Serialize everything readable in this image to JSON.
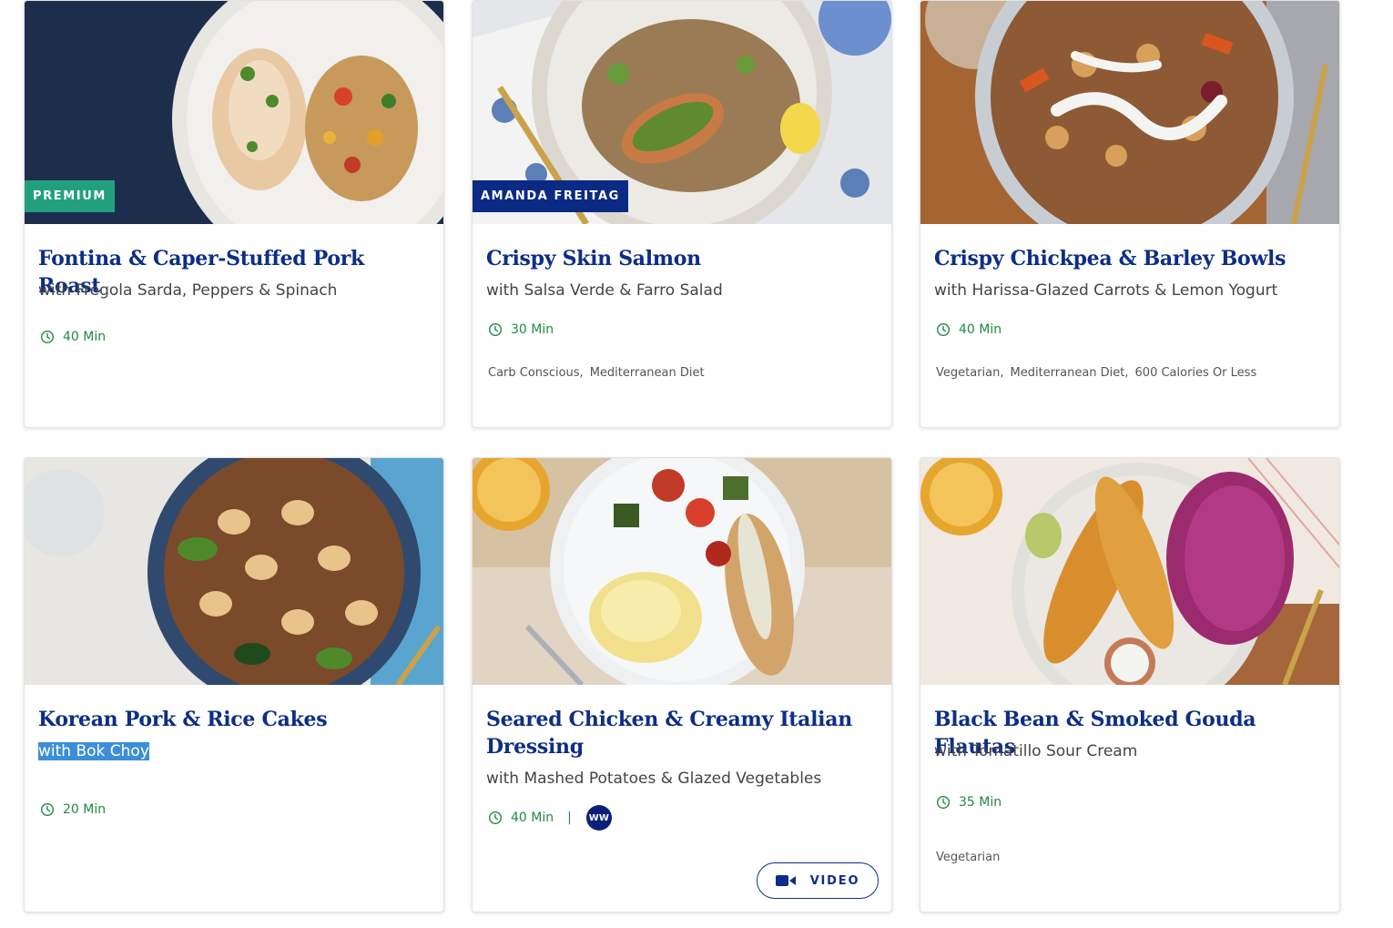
{
  "recipes": [
    {
      "badge": "PREMIUM",
      "title": "Fontina & Caper-Stuffed Pork Roast",
      "subtitle": "with Fregola Sarda, Peppers & Spinach",
      "time": "40 Min",
      "tags": []
    },
    {
      "badge": "AMANDA FREITAG",
      "title": "Crispy Skin Salmon",
      "subtitle": "with Salsa Verde & Farro Salad",
      "time": "30 Min",
      "tags": [
        "Carb Conscious,",
        "Mediterranean Diet"
      ]
    },
    {
      "badge": "",
      "title": "Crispy Chickpea & Barley Bowls",
      "subtitle": "with Harissa-Glazed Carrots & Lemon Yogurt",
      "time": "40 Min",
      "tags": [
        "Vegetarian,",
        "Mediterranean Diet,",
        "600 Calories Or Less"
      ]
    },
    {
      "badge": "",
      "title": "Korean Pork & Rice Cakes",
      "subtitle": "with Bok Choy",
      "time": "20 Min",
      "tags": []
    },
    {
      "badge": "",
      "title": "Seared Chicken & Creamy Italian Dressing",
      "subtitle": "with Mashed Potatoes & Glazed Vegetables",
      "time": "40 Min",
      "separator": "|",
      "ww_label": "WW",
      "video_label": "VIDEO",
      "tags": []
    },
    {
      "badge": "",
      "title": "Black Bean & Smoked Gouda Flautas",
      "subtitle": "with Tomatillo Sour Cream",
      "time": "35 Min",
      "tags": [
        "Vegetarian"
      ]
    }
  ],
  "icons": {
    "time": "clock-icon",
    "video": "video-camera-icon",
    "ww": "ww-logo-icon"
  },
  "colors": {
    "title": "#0c2e86",
    "time": "#228a44",
    "premium_badge": "#22a07e",
    "chef_badge": "#0b2a84",
    "selection": "#3d8ed9"
  }
}
